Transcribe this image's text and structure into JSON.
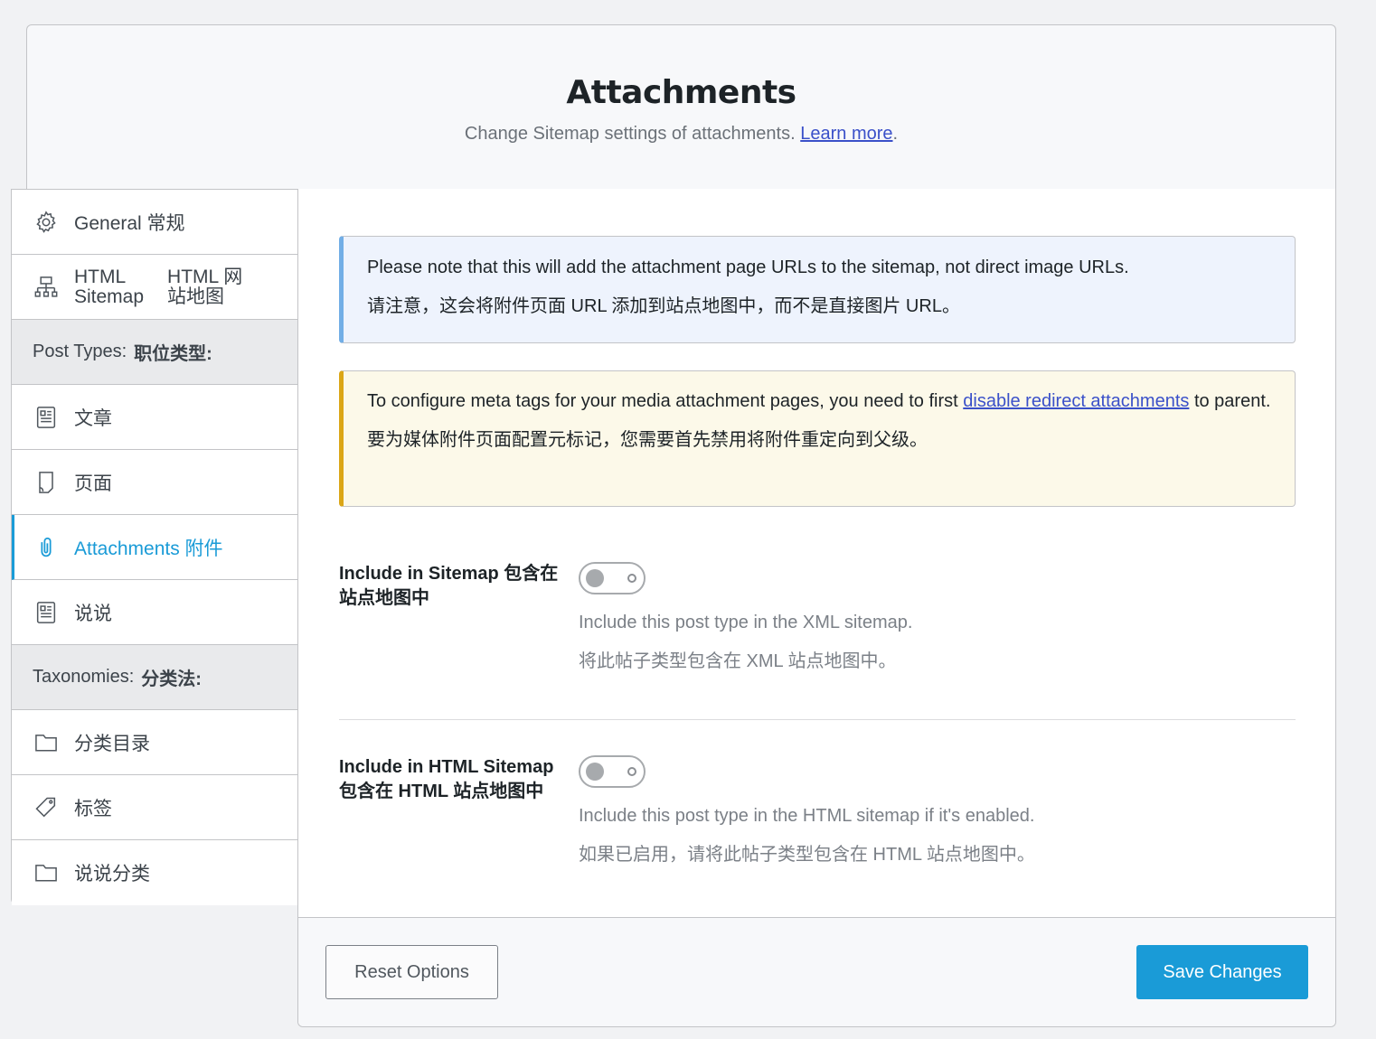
{
  "header": {
    "title": "Attachments",
    "subtitle": "Change Sitemap settings of attachments.",
    "learn_more": "Learn more",
    "period": "."
  },
  "sidebar": {
    "general": "General 常规",
    "html_sitemap_line1_en": "HTML",
    "html_sitemap_line2_en": "Sitemap",
    "html_sitemap_line1_zh": "HTML 网",
    "html_sitemap_line2_zh": "站地图",
    "post_types_en": "Post Types:",
    "post_types_zh": "职位类型:",
    "post": "文章",
    "page": "页面",
    "attachments": "Attachments 附件",
    "shuoshuo": "说说",
    "taxonomies_en": "Taxonomies:",
    "taxonomies_zh": "分类法:",
    "category": "分类目录",
    "tags": "标签",
    "shuoshuo_category": "说说分类"
  },
  "notices": {
    "info_en": "Please note that this will add the attachment page URLs to the sitemap, not direct image URLs.",
    "info_zh": "请注意，这会将附件页面 URL 添加到站点地图中，而不是直接图片 URL。",
    "warn_en_before": "To configure meta tags for your media attachment pages, you need to first ",
    "warn_link": "disable redirect attachments",
    "warn_en_after": " to parent.",
    "warn_zh": "要为媒体附件页面配置元标记，您需要首先禁用将附件重定向到父级。"
  },
  "fields": {
    "include_sitemap": {
      "label": "Include in Sitemap 包含在站点地图中",
      "enabled": false,
      "desc_en": "Include this post type in the XML sitemap.",
      "desc_zh": "将此帖子类型包含在 XML 站点地图中。"
    },
    "include_html_sitemap": {
      "label": "Include in HTML Sitemap 包含在 HTML 站点地图中",
      "enabled": false,
      "desc_en": "Include this post type in the HTML sitemap if it's enabled.",
      "desc_zh": "如果已启用，请将此帖子类型包含在 HTML 站点地图中。"
    }
  },
  "footer": {
    "reset_label": "Reset Options",
    "save_label": "Save Changes"
  },
  "colors": {
    "accent": "#1a9bd7",
    "info_border": "#72aee6",
    "warn_border": "#dba617"
  }
}
